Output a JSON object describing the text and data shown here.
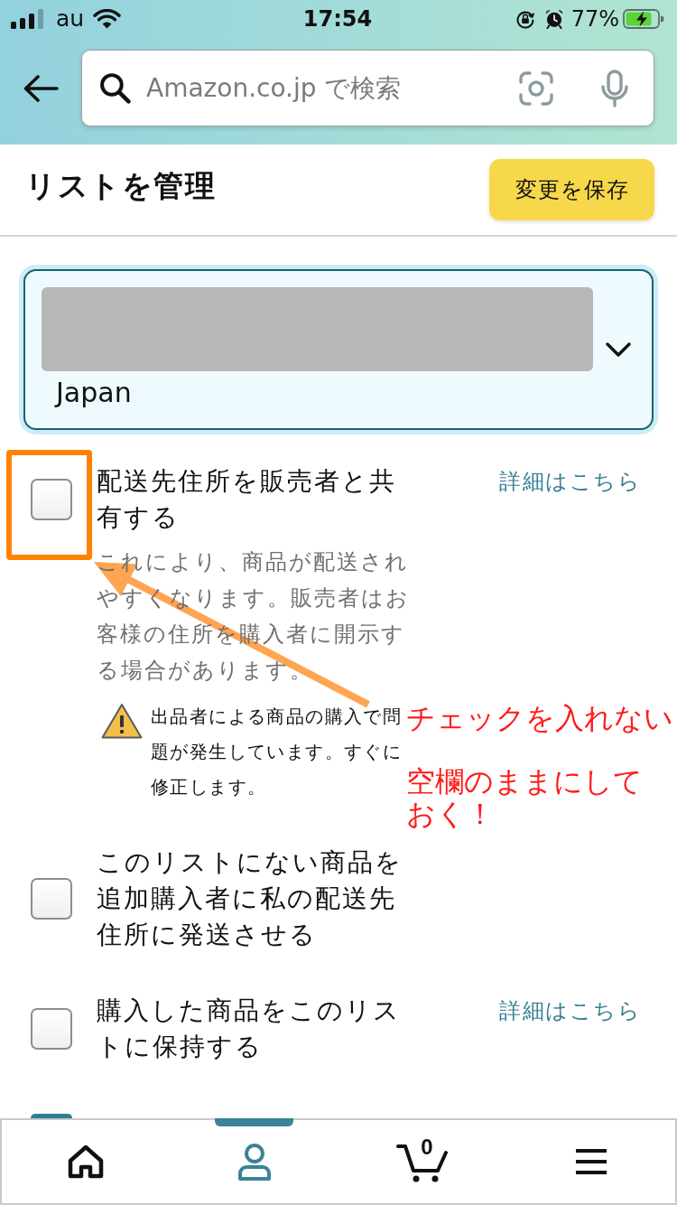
{
  "status_bar": {
    "carrier": "au",
    "time": "17:54",
    "battery": "77%"
  },
  "search_bar": {
    "placeholder": "Amazon.co.jp で検索"
  },
  "page": {
    "title": "リストを管理",
    "save_button": "変更を保存"
  },
  "address_dropdown": {
    "address_redacted": true,
    "country": "Japan"
  },
  "options": [
    {
      "kind": "full",
      "checked": false,
      "highlighted": true,
      "label": "配送先住所を販売者と共有する",
      "link": "詳細はこちら",
      "description": "これにより、商品が配送されやすくなります。販売者はお客様の住所を購入者に開示する場合があります。",
      "warning": "出品者による商品の購入で問題が発生しています。すぐに修正します。"
    },
    {
      "kind": "full",
      "checked": false,
      "highlighted": false,
      "label": "このリストにない商品を追加購入者に私の配送先住所に発送させる"
    },
    {
      "kind": "full",
      "checked": false,
      "highlighted": false,
      "label": "購入した商品をこのリストに保持する",
      "link": "詳細はこちら"
    },
    {
      "kind": "clipped",
      "checked": true,
      "highlighted": false
    }
  ],
  "tab_bar": {
    "tabs": [
      {
        "kind": "home",
        "selected": false
      },
      {
        "kind": "account",
        "selected": true
      },
      {
        "kind": "cart",
        "selected": false,
        "count": "0"
      },
      {
        "kind": "menu",
        "selected": false
      }
    ]
  },
  "annotation": {
    "arrow": true,
    "callouts": [
      "チェックを入れない",
      "空欄のままにしておく！"
    ]
  }
}
